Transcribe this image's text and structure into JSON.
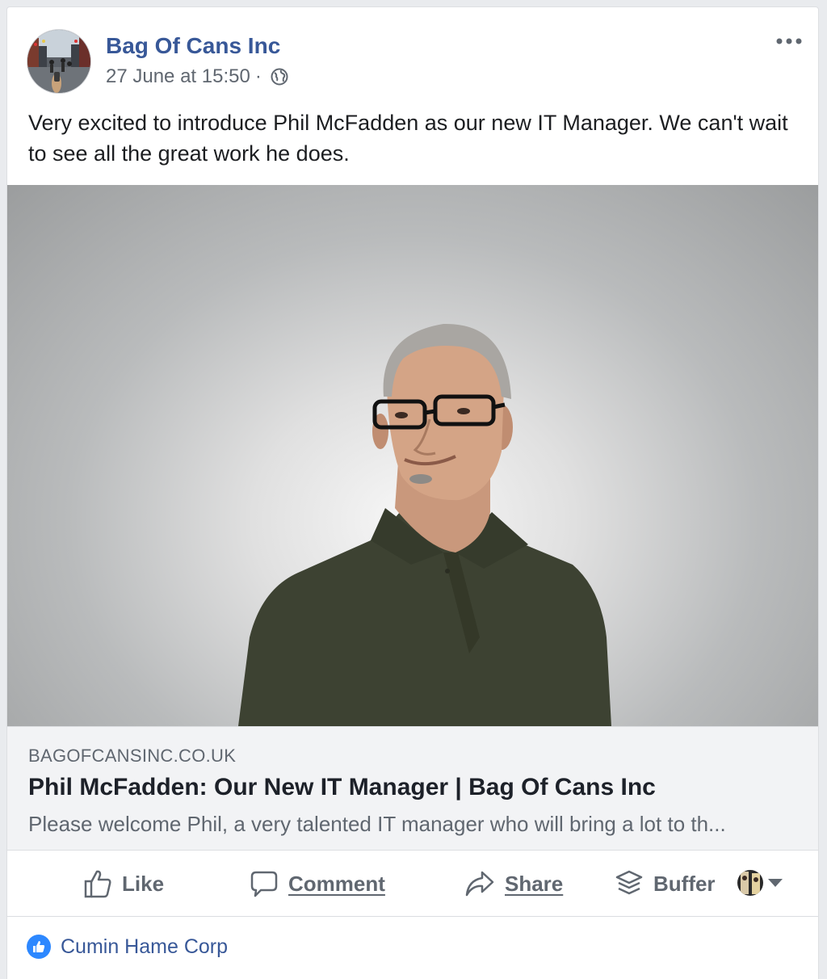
{
  "post": {
    "page_name": "Bag Of Cans Inc",
    "timestamp": "27 June at 15:50",
    "separator": "·",
    "privacy_icon": "globe-icon",
    "menu_icon": "more-options-icon",
    "text": "Very excited to introduce Phil McFadden as our new IT Manager. We can't wait to see all the great work he does."
  },
  "link_preview": {
    "domain": "BAGOFCANSINC.CO.UK",
    "title": "Phil McFadden: Our New IT Manager | Bag Of Cans Inc",
    "description": "Please welcome Phil, a very talented IT manager who will bring a lot to th..."
  },
  "actions": {
    "like_label": "Like",
    "comment_label": "Comment",
    "share_label": "Share",
    "buffer_label": "Buffer",
    "like_icon": "thumbs-up-icon",
    "comment_icon": "speech-bubble-icon",
    "share_icon": "share-arrow-icon",
    "buffer_icon": "buffer-stack-icon"
  },
  "reactions": {
    "icon": "like-badge-icon",
    "liker_name": "Cumin Hame Corp"
  },
  "colors": {
    "link_blue": "#385898",
    "text": "#1c1e21",
    "secondary": "#606770",
    "like_blue": "#2d88ff",
    "preview_bg": "#f2f3f5"
  }
}
